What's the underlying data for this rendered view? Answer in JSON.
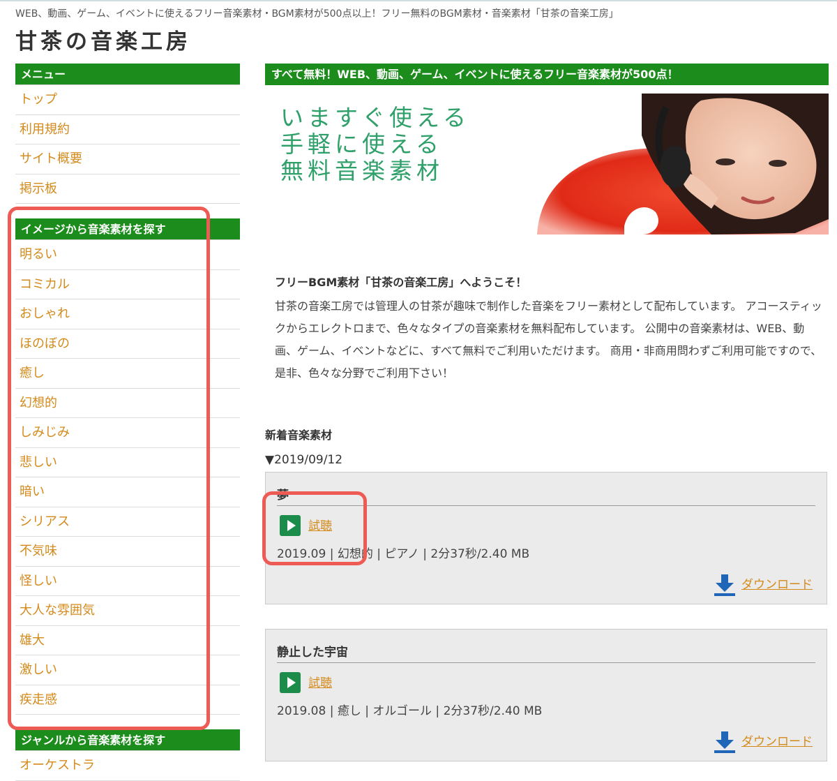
{
  "header": {
    "tagline": "WEB、動画、ゲーム、イベントに使えるフリー音楽素材・BGM素材が500点以上！フリー無料のBGM素材・音楽素材「甘茶の音楽工房」",
    "site_title": "甘茶の音楽工房"
  },
  "sidebar": {
    "menu_heading": "メニュー",
    "menu_items": [
      "トップ",
      "利用規約",
      "サイト概要",
      "掲示板"
    ],
    "image_heading": "イメージから音楽素材を探す",
    "image_items": [
      "明るい",
      "コミカル",
      "おしゃれ",
      "ほのぼの",
      "癒し",
      "幻想的",
      "しみじみ",
      "悲しい",
      "暗い",
      "シリアス",
      "不気味",
      "怪しい",
      "大人な雰囲気",
      "雄大",
      "激しい",
      "疾走感"
    ],
    "genre_heading": "ジャンルから音楽素材を探す",
    "genre_first_item": "オーケストラ"
  },
  "main": {
    "heading": "すべて無料！WEB、動画、ゲーム、イベントに使えるフリー音楽素材が500点！",
    "hero_lines": [
      "いますぐ使える",
      "手軽に使える",
      "無料音楽素材"
    ],
    "intro_title": "フリーBGM素材「甘茶の音楽工房」へようこそ！",
    "intro_body": "甘茶の音楽工房では管理人の甘茶が趣味で制作した音楽をフリー素材として配布しています。 アコースティックからエレクトロまで、色々なタイプの音楽素材を無料配布しています。 公開中の音楽素材は、WEB、動画、ゲーム、イベントなどに、すべて無料でご利用いただけます。 商用・非商用問わずご利用可能ですので、是非、色々な分野でご利用下さい！",
    "new_heading": "新着音楽素材",
    "date_heading": "▼2019/09/12",
    "tracks": [
      {
        "title": "夢",
        "listen": "試聴",
        "meta": "2019.09 | 幻想的 | ピアノ | 2分37秒/2.40 MB",
        "download": "ダウンロード"
      },
      {
        "title": "静止した宇宙",
        "listen": "試聴",
        "meta": "2019.08 | 癒し | オルゴール | 2分37秒/2.40 MB",
        "download": "ダウンロード"
      }
    ]
  },
  "colors": {
    "heading_green": "#1c8c1c",
    "link_orange": "#d48a1b",
    "highlight_red": "#ee5b55",
    "hero_text_green": "#2fa06a"
  },
  "icons": [
    "play-icon",
    "download-icon"
  ]
}
